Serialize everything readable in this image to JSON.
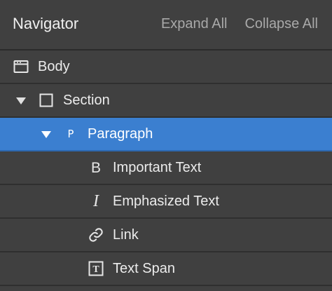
{
  "navigator": {
    "title": "Navigator",
    "expand_all": "Expand All",
    "collapse_all": "Collapse All"
  },
  "tree": {
    "items": [
      {
        "label": "Body",
        "icon": "body-icon",
        "depth": 0,
        "expanded": null,
        "selected": false
      },
      {
        "label": "Section",
        "icon": "section-icon",
        "depth": 1,
        "expanded": true,
        "selected": false
      },
      {
        "label": "Paragraph",
        "icon": "paragraph-icon",
        "icon_glyph": "P",
        "depth": 2,
        "expanded": true,
        "selected": true
      },
      {
        "label": "Important Text",
        "icon": "bold-icon",
        "icon_glyph": "B",
        "depth": 3,
        "expanded": null,
        "selected": false
      },
      {
        "label": "Emphasized Text",
        "icon": "italic-icon",
        "icon_glyph": "I",
        "depth": 3,
        "expanded": null,
        "selected": false
      },
      {
        "label": "Link",
        "icon": "link-icon",
        "depth": 3,
        "expanded": null,
        "selected": false
      },
      {
        "label": "Text Span",
        "icon": "text-span-icon",
        "icon_glyph": "T",
        "depth": 3,
        "expanded": null,
        "selected": false
      }
    ]
  },
  "colors": {
    "panel_bg": "#404040",
    "selected_bg": "#3b7fd0",
    "header_button": "#a9a9a9",
    "text": "#ececec"
  }
}
